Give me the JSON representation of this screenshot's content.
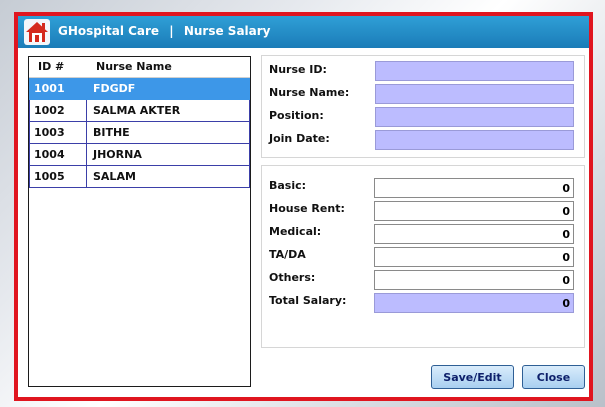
{
  "window": {
    "app_name": "GHospital Care",
    "separator": "|",
    "title": "Nurse Salary",
    "icon": "home-icon"
  },
  "nurse_list": {
    "columns": [
      "ID #",
      "Nurse Name"
    ],
    "rows": [
      {
        "id": "1001",
        "name": "FDGDF",
        "selected": true
      },
      {
        "id": "1002",
        "name": "SALMA AKTER",
        "selected": false
      },
      {
        "id": "1003",
        "name": "BITHE",
        "selected": false
      },
      {
        "id": "1004",
        "name": "JHORNA",
        "selected": false
      },
      {
        "id": "1005",
        "name": "SALAM",
        "selected": false
      }
    ]
  },
  "nurse_info": {
    "nurse_id": {
      "label": "Nurse ID:",
      "value": ""
    },
    "nurse_name": {
      "label": "Nurse Name:",
      "value": ""
    },
    "position": {
      "label": "Position:",
      "value": ""
    },
    "join_date": {
      "label": "Join Date:",
      "value": ""
    }
  },
  "salary": {
    "basic": {
      "label": "Basic:",
      "value": "0"
    },
    "house_rent": {
      "label": "House Rent:",
      "value": "0"
    },
    "medical": {
      "label": "Medical:",
      "value": "0"
    },
    "ta_da": {
      "label": "TA/DA",
      "value": "0"
    },
    "others": {
      "label": "Others:",
      "value": "0"
    },
    "total": {
      "label": "Total Salary:",
      "value": "0"
    }
  },
  "buttons": {
    "save_edit": "Save/Edit",
    "close": "Close"
  },
  "colors": {
    "window_border": "#e0151f",
    "titlebar": "#1f86c4",
    "selected_row": "#3d97e8",
    "input_highlight": "#bcbcff"
  }
}
